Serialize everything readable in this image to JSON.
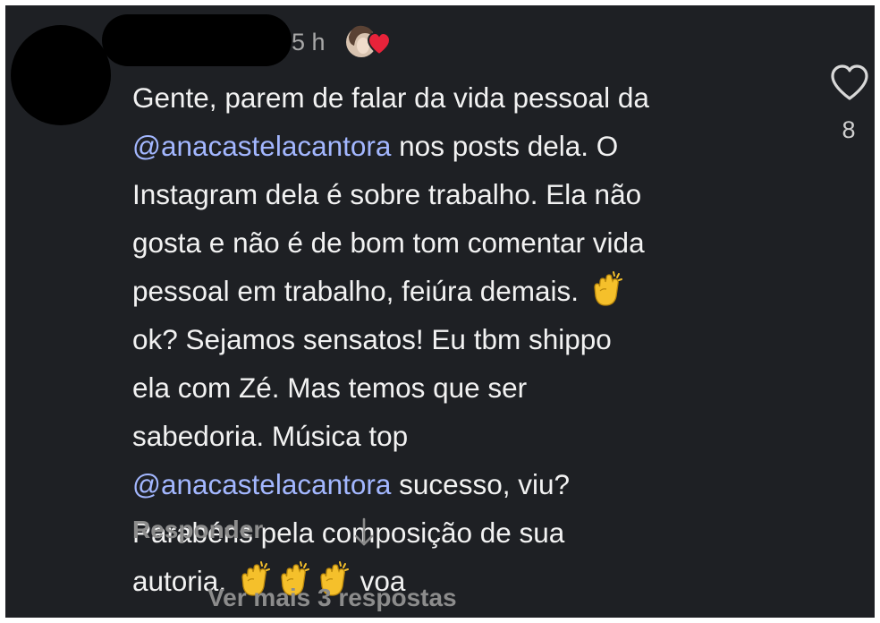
{
  "comment": {
    "timestamp": "5 h",
    "author_like_icon": "author-avatar-with-heart-icon",
    "lines": [
      {
        "parts": [
          {
            "text": "Gente, parem de falar da vida pessoal da"
          }
        ]
      },
      {
        "parts": [
          {
            "text": "@anacastelacantora",
            "mention": true
          },
          {
            "text": " nos posts dela. O"
          }
        ]
      },
      {
        "parts": [
          {
            "text": "Instagram dela é sobre trabalho. Ela não"
          }
        ]
      },
      {
        "parts": [
          {
            "text": "gosta e não é de bom tom comentar vida"
          }
        ]
      },
      {
        "parts": [
          {
            "text": "pessoal em trabalho, feiúra demais. "
          },
          {
            "emoji": "clapping-hands"
          }
        ]
      },
      {
        "parts": [
          {
            "text": "ok? Sejamos sensatos! Eu tbm shippo"
          }
        ]
      },
      {
        "parts": [
          {
            "text": "ela com Zé. Mas temos que ser"
          }
        ]
      },
      {
        "parts": [
          {
            "text": "sabedoria.  Música top"
          }
        ]
      },
      {
        "parts": [
          {
            "text": "@anacastelacantora",
            "mention": true
          },
          {
            "text": " sucesso, viu?"
          }
        ]
      },
      {
        "parts": [
          {
            "text": "Parabéns pela composição de sua"
          }
        ]
      },
      {
        "parts": [
          {
            "text": "autoria. "
          },
          {
            "emoji": "clapping-hands"
          },
          {
            "emoji": "clapping-hands"
          },
          {
            "emoji": "clapping-hands"
          },
          {
            "text": " voa"
          }
        ]
      }
    ]
  },
  "like": {
    "icon": "heart-outline-icon",
    "count": "8"
  },
  "actions": {
    "reply_label": "Responder",
    "arrow_icon": "arrow-down-icon",
    "more_replies_label": "Ver mais 3 respostas"
  },
  "colors": {
    "background": "#1e2024",
    "text": "#f2f2f2",
    "mention": "#a3b7ff",
    "muted": "#8c8c8c",
    "emoji": "#f5c02b",
    "author_heart": "#e8233a"
  }
}
